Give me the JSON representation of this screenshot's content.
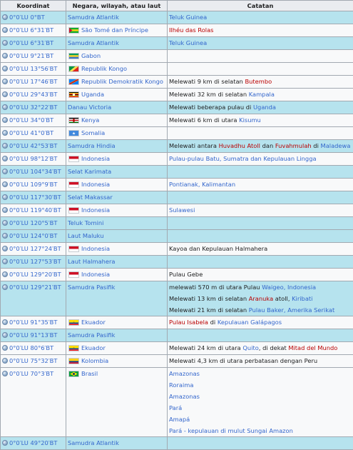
{
  "headers": {
    "coord": "Koordinat",
    "country": "Negara, wilayah, atau laut",
    "notes": "Catatan"
  },
  "rows": [
    {
      "type": "sea",
      "coord": "0°0′LU 0°BT",
      "place": "Samudra Atlantik",
      "note": [
        {
          "t": "Teluk Guinea",
          "c": "link"
        }
      ]
    },
    {
      "type": "land",
      "coord": "0°0′LU 6°31′BT",
      "place": "São Tomé dan Príncipe",
      "flag": "stp",
      "note": [
        {
          "t": "Ilhéu das Rolas",
          "c": "red"
        }
      ]
    },
    {
      "type": "sea",
      "coord": "0°0′LU 6°31′BT",
      "place": "Samudra Atlantik",
      "note": [
        {
          "t": "Teluk Guinea",
          "c": "link"
        }
      ]
    },
    {
      "type": "land",
      "coord": "0°0′LU 9°21′BT",
      "place": "Gabon",
      "flag": "gab",
      "note": []
    },
    {
      "type": "land",
      "coord": "0°0′LU 13°56′BT",
      "place": "Republik Kongo",
      "flag": "cog",
      "note": []
    },
    {
      "type": "land",
      "coord": "0°0′LU 17°46′BT",
      "place": "Republik Demokratik Kongo",
      "flag": "cod",
      "note": [
        {
          "t": "Melewati 9 km di selatan "
        },
        {
          "t": "Butembo",
          "c": "red"
        }
      ]
    },
    {
      "type": "land",
      "coord": "0°0′LU 29°43′BT",
      "place": "Uganda",
      "flag": "uga",
      "note": [
        {
          "t": "Melewati 32 km di selatan "
        },
        {
          "t": "Kampala",
          "c": "link"
        }
      ]
    },
    {
      "type": "sea",
      "coord": "0°0′LU 32°22′BT",
      "place": "Danau Victoria",
      "note": [
        {
          "t": "Melewati beberapa pulau di "
        },
        {
          "t": "Uganda",
          "c": "link"
        }
      ]
    },
    {
      "type": "land",
      "coord": "0°0′LU 34°0′BT",
      "place": "Kenya",
      "flag": "ken",
      "note": [
        {
          "t": "Melewati 6 km di utara "
        },
        {
          "t": "Kisumu",
          "c": "link"
        }
      ]
    },
    {
      "type": "land",
      "coord": "0°0′LU 41°0′BT",
      "place": "Somalia",
      "flag": "som",
      "note": []
    },
    {
      "type": "sea",
      "coord": "0°0′LU 42°53′BT",
      "place": "Samudra Hindia",
      "note": [
        {
          "t": "Melewati antara "
        },
        {
          "t": "Huvadhu Atoll",
          "c": "red"
        },
        {
          "t": " dan "
        },
        {
          "t": "Fuvahmulah",
          "c": "red"
        },
        {
          "t": " di "
        },
        {
          "t": "Maladewa",
          "c": "link"
        }
      ]
    },
    {
      "type": "land",
      "coord": "0°0′LU 98°12′BT",
      "place": "Indonesia",
      "flag": "idn",
      "note": [
        {
          "t": "Pulau-pulau Batu, Sumatra dan Kepulauan Lingga",
          "c": "link"
        }
      ]
    },
    {
      "type": "sea",
      "coord": "0°0′LU 104°34′BT",
      "place": "Selat Karimata",
      "note": []
    },
    {
      "type": "land",
      "coord": "0°0′LU 109°9′BT",
      "place": "Indonesia",
      "flag": "idn",
      "note": [
        {
          "t": "Pontianak, Kalimantan",
          "c": "link"
        }
      ]
    },
    {
      "type": "sea",
      "coord": "0°0′LU 117°30′BT",
      "place": "Selat Makassar",
      "note": []
    },
    {
      "type": "land",
      "coord": "0°0′LU 119°40′BT",
      "place": "Indonesia",
      "flag": "idn",
      "note": [
        {
          "t": "Sulawesi",
          "c": "link"
        }
      ]
    },
    {
      "type": "sea",
      "coord": "0°0′LU 120°5′BT",
      "place": "Teluk Tomini",
      "note": []
    },
    {
      "type": "sea",
      "coord": "0°0′LU 124°0′BT",
      "place": "Laut Maluku",
      "note": []
    },
    {
      "type": "land",
      "coord": "0°0′LU 127°24′BT",
      "place": "Indonesia",
      "flag": "idn",
      "note": [
        {
          "t": "Kayoa dan Kepulauan Halmahera"
        }
      ]
    },
    {
      "type": "sea",
      "coord": "0°0′LU 127°53′BT",
      "place": "Laut Halmahera",
      "note": []
    },
    {
      "type": "land",
      "coord": "0°0′LU 129°20′BT",
      "place": "Indonesia",
      "flag": "idn",
      "note": [
        {
          "t": "Pulau Gebe"
        }
      ]
    },
    {
      "type": "sea",
      "coord": "0°0′LU 129°21′BT",
      "place": "Samudra Pasifik",
      "lines": [
        [
          {
            "t": "melewati 570 m di utara Pulau "
          },
          {
            "t": "Waigeo, Indonesia",
            "c": "link"
          }
        ],
        [
          {
            "t": "Melewati 13 km di selatan "
          },
          {
            "t": "Aranuka",
            "c": "red"
          },
          {
            "t": " atoll, "
          },
          {
            "t": "Kiribati",
            "c": "link"
          }
        ],
        [
          {
            "t": "Melewati 21 km di selatan "
          },
          {
            "t": "Pulau Baker, Amerika Serikat",
            "c": "link"
          }
        ]
      ]
    },
    {
      "type": "land",
      "coord": "0°0′LU 91°35′BT",
      "place": "Ekuador",
      "flag": "ecu",
      "note": [
        {
          "t": "Pulau Isabela",
          "c": "red"
        },
        {
          "t": " di "
        },
        {
          "t": "Kepulauan Galápagos",
          "c": "link"
        }
      ]
    },
    {
      "type": "sea",
      "coord": "0°0′LU 91°13′BT",
      "place": "Samudra Pasifik",
      "note": []
    },
    {
      "type": "land",
      "coord": "0°0′LU 80°6′BT",
      "place": "Ekuador",
      "flag": "ecu",
      "note": [
        {
          "t": "Melewati 24 km di utara "
        },
        {
          "t": "Quito",
          "c": "link"
        },
        {
          "t": ", di dekat "
        },
        {
          "t": "Mitad del Mundo",
          "c": "red"
        }
      ]
    },
    {
      "type": "land",
      "coord": "0°0′LU 75°32′BT",
      "place": "Kolombia",
      "flag": "col",
      "note": [
        {
          "t": "Melewati 4,3 km di utara perbatasan dengan Peru"
        }
      ]
    },
    {
      "type": "land",
      "coord": "0°0′LU 70°3′BT",
      "place": "Brasil",
      "flag": "bra",
      "lines": [
        [
          {
            "t": "Amazonas",
            "c": "link"
          }
        ],
        [
          {
            "t": "Roraima",
            "c": "link"
          }
        ],
        [
          {
            "t": "Amazonas",
            "c": "link"
          }
        ],
        [
          {
            "t": "Pará",
            "c": "link"
          }
        ],
        [
          {
            "t": "Amapá",
            "c": "link"
          }
        ],
        [
          {
            "t": "Pará - kepulauan di mulut Sungai Amazon",
            "c": "link"
          }
        ]
      ]
    },
    {
      "type": "sea",
      "coord": "0°0′LU 49°20′BT",
      "place": "Samudra Atlantik",
      "note": []
    }
  ],
  "colors": {
    "sea": "#b6e3ee",
    "land": "#f8f9fa",
    "link": "#3366cc",
    "redlink": "#ba0000",
    "border": "#a2a9b1"
  }
}
